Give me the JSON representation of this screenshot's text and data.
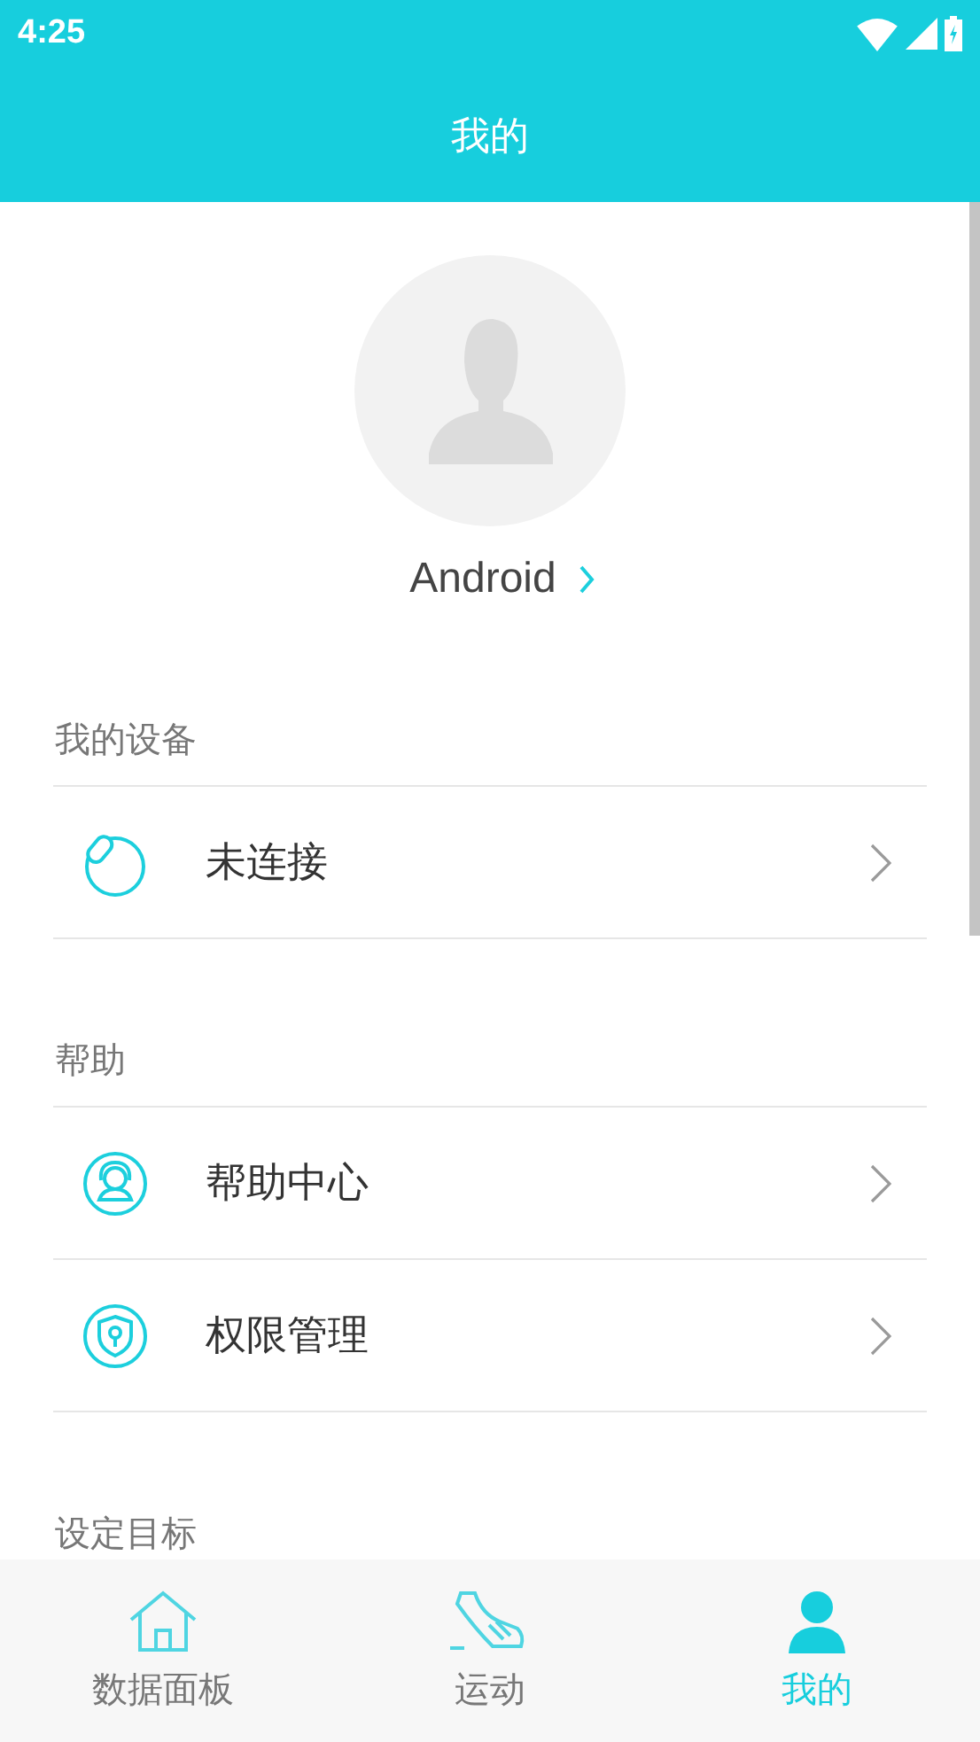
{
  "status_bar": {
    "time": "4:25"
  },
  "app_bar": {
    "title": "我的"
  },
  "profile": {
    "name": "Android"
  },
  "sections": [
    {
      "title": "我的设备",
      "items": [
        {
          "kind": "device",
          "label": "未连接"
        }
      ]
    },
    {
      "title": "帮助",
      "items": [
        {
          "kind": "help",
          "label": "帮助中心"
        },
        {
          "kind": "permission",
          "label": "权限管理"
        }
      ]
    },
    {
      "title": "设定目标"
    }
  ],
  "bottom_nav": [
    {
      "kind": "home",
      "label": "数据面板",
      "selected": false
    },
    {
      "kind": "shoe",
      "label": "运动",
      "selected": false
    },
    {
      "kind": "person",
      "label": "我的",
      "selected": true
    }
  ]
}
